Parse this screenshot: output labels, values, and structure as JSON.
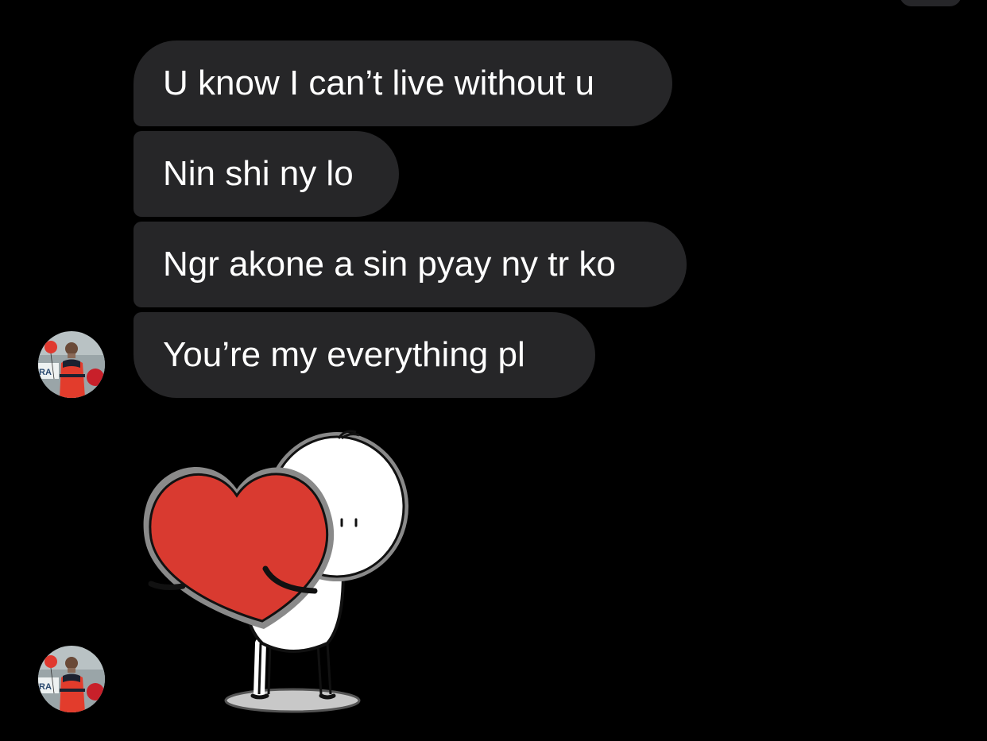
{
  "conversation": {
    "messages": [
      {
        "text": "U know I can’t live without u"
      },
      {
        "text": "Nin shi ny lo"
      },
      {
        "text": "Ngr akone a sin pyay ny tr ko"
      },
      {
        "text": "You’re my everything pl"
      }
    ],
    "sticker": {
      "icon": "heart-hug-sticker-icon"
    }
  },
  "sender": {
    "avatar_icon": "profile-avatar"
  },
  "colors": {
    "background": "#000000",
    "bubble": "#262628",
    "bubble_text": "#ffffff",
    "heart": "#d93a30"
  }
}
